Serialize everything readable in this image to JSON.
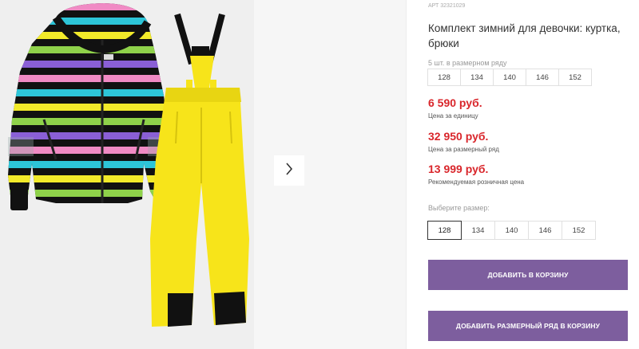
{
  "product": {
    "sku": "АРТ 32321029",
    "title": "Комплект зимний для девочки: куртка, брюки"
  },
  "size_row": {
    "hint": "5 шт. в размерном ряду",
    "sizes": [
      "128",
      "134",
      "140",
      "146",
      "152"
    ]
  },
  "prices": {
    "unit_price": "6 590 руб.",
    "unit_label": "Цена за единицу",
    "row_price": "32 950 руб.",
    "row_label": "Цена за размерный ряд",
    "retail_price": "13 999 руб.",
    "retail_label": "Рекомендуемая розничная цена"
  },
  "size_select": {
    "hint": "Выберите размер:",
    "sizes": [
      "128",
      "134",
      "140",
      "146",
      "152"
    ],
    "selected": "128"
  },
  "buttons": {
    "add_to_cart": "ДОБАВИТЬ В КОРЗИНУ",
    "add_row_to_cart": "ДОБАВИТЬ РАЗМЕРНЫЙ РЯД В КОРЗИНУ"
  },
  "colors": {
    "price": "#d9262b",
    "button": "#7d5e9e",
    "pants": "#f7e41a",
    "jacket_stripes": [
      "#f08ac4",
      "#2dc5d8",
      "#f2ea2a",
      "#8fd24a",
      "#8a5fd6"
    ]
  },
  "icons": {
    "gallery_next": "chevron-right-icon"
  }
}
